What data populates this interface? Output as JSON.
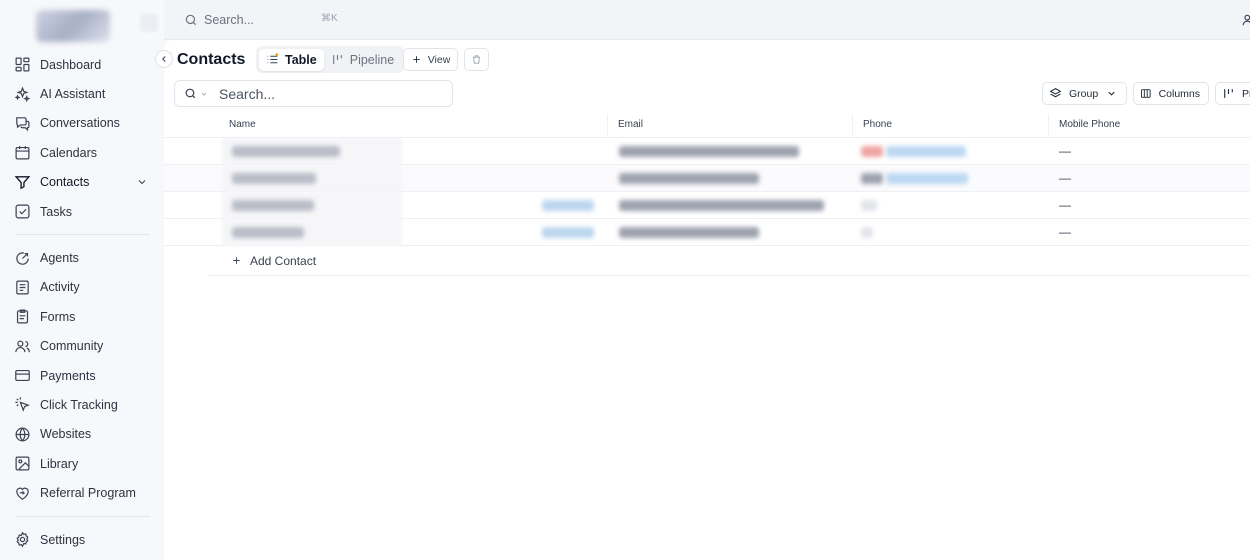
{
  "topbar": {
    "search_label": "Search...",
    "shortcut": "⌘K"
  },
  "sidebar": {
    "groups": [
      [
        {
          "label": "Dashboard",
          "icon": "dashboard-icon"
        },
        {
          "label": "AI Assistant",
          "icon": "sparkles-icon"
        },
        {
          "label": "Conversations",
          "icon": "chat-icon"
        },
        {
          "label": "Calendars",
          "icon": "calendar-icon"
        },
        {
          "label": "Contacts",
          "icon": "filter-icon",
          "active": true,
          "has_chevron": true
        },
        {
          "label": "Tasks",
          "icon": "task-check-icon"
        }
      ],
      [
        {
          "label": "Agents",
          "icon": "agent-icon"
        },
        {
          "label": "Activity",
          "icon": "activity-icon"
        },
        {
          "label": "Forms",
          "icon": "forms-icon"
        },
        {
          "label": "Community",
          "icon": "community-icon"
        },
        {
          "label": "Payments",
          "icon": "credit-card-icon"
        },
        {
          "label": "Click Tracking",
          "icon": "click-icon"
        },
        {
          "label": "Websites",
          "icon": "globe-icon"
        },
        {
          "label": "Library",
          "icon": "image-library-icon"
        },
        {
          "label": "Referral Program",
          "icon": "referral-icon"
        }
      ],
      [
        {
          "label": "Settings",
          "icon": "gear-icon"
        }
      ]
    ]
  },
  "main": {
    "title": "Contacts",
    "tabs": [
      {
        "label": "Table",
        "icon": "list-icon",
        "active": true
      },
      {
        "label": "Pipeline",
        "icon": "pipeline-icon",
        "active": false
      }
    ],
    "view_label": "View",
    "search_placeholder": "Search...",
    "group_label": "Group",
    "columns_label": "Columns",
    "pin_label": "Pi",
    "columns": [
      "Name",
      "Email",
      "Phone",
      "Mobile Phone"
    ],
    "rows": [
      {
        "mobile": "—"
      },
      {
        "mobile": "—"
      },
      {
        "mobile": "—"
      },
      {
        "mobile": "—"
      }
    ],
    "add_contact_label": "Add Contact"
  },
  "colors": {
    "accent": "#111827",
    "muted": "#6b7280",
    "border": "#e2e4ea",
    "background": "#f7f8fb"
  }
}
